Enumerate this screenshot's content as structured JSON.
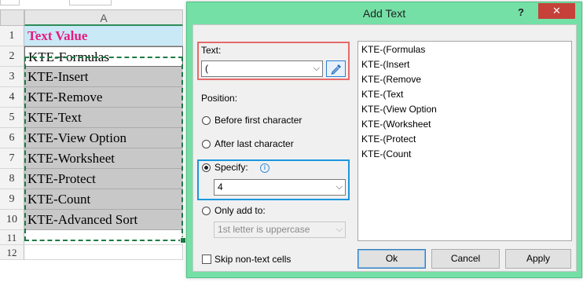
{
  "spreadsheet": {
    "column_header": "A",
    "rows": [
      {
        "num": "1",
        "value": "Text Value",
        "kind": "header"
      },
      {
        "num": "2",
        "value": "KTE-Formulas",
        "kind": "active"
      },
      {
        "num": "3",
        "value": "KTE-Insert",
        "kind": "selected"
      },
      {
        "num": "4",
        "value": "KTE-Remove",
        "kind": "selected"
      },
      {
        "num": "5",
        "value": "KTE-Text",
        "kind": "selected"
      },
      {
        "num": "6",
        "value": "KTE-View Option",
        "kind": "selected"
      },
      {
        "num": "7",
        "value": "KTE-Worksheet",
        "kind": "selected"
      },
      {
        "num": "8",
        "value": "KTE-Protect",
        "kind": "selected"
      },
      {
        "num": "9",
        "value": "KTE-Count",
        "kind": "selected"
      },
      {
        "num": "10",
        "value": "KTE-Advanced Sort",
        "kind": "selected"
      },
      {
        "num": "11",
        "value": "",
        "kind": "empty"
      },
      {
        "num": "12",
        "value": "",
        "kind": "empty"
      }
    ],
    "colors": {
      "header_fill": "#c9e9f7",
      "header_text": "#e8197d",
      "selection_fill": "#c8c8c8",
      "selection_border": "#1f7a44"
    }
  },
  "dialog": {
    "title": "Add Text",
    "help_label": "?",
    "close_label": "✕",
    "text_label": "Text:",
    "text_value": "(",
    "picker_icon": "eyedropper-icon",
    "position_label": "Position:",
    "opt_before": "Before first character",
    "opt_after": "After last character",
    "opt_specify": "Specify:",
    "specify_value": "4",
    "opt_only": "Only add to:",
    "only_value": "1st letter is uppercase",
    "skip_label": "Skip non-text cells",
    "preview_items": [
      "KTE-(Formulas",
      "KTE-(Insert",
      "KTE-(Remove",
      "KTE-(Text",
      "KTE-(View Option",
      "KTE-(Worksheet",
      "KTE-(Protect",
      "KTE-(Count"
    ],
    "buttons": {
      "ok": "Ok",
      "cancel": "Cancel",
      "apply": "Apply"
    },
    "colors": {
      "frame": "#74e0a6",
      "close": "#c5413a",
      "text_highlight": "#e66a6a",
      "specify_highlight": "#1c96de"
    }
  }
}
